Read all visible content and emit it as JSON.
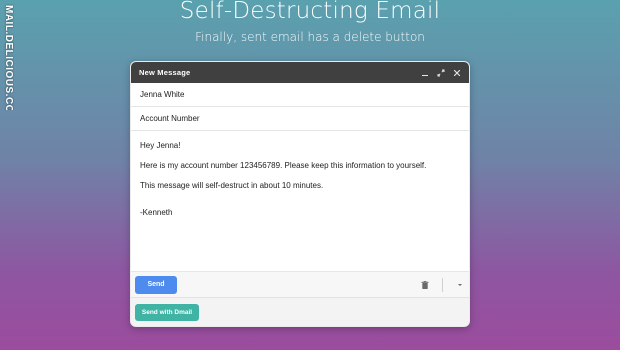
{
  "watermark": "MAIL.DELICIOUS.COM",
  "hero": {
    "title": "Self-Destructing Email",
    "subtitle": "Finally, sent email has a delete button"
  },
  "compose": {
    "header_title": "New Message",
    "icons": {
      "minimize": "minimize-icon",
      "expand": "expand-icon",
      "close": "close-icon"
    },
    "recipient": "Jenna White",
    "subject": "Account Number",
    "body_lines": [
      "Hey Jenna!",
      "Here is my account number 123456789. Please keep this information to yourself.",
      "This message will self-destruct in about 10 minutes.",
      "-Kenneth"
    ],
    "send_label": "Send",
    "trash_icon": "trash-icon",
    "more_icon": "chevron-down-icon",
    "dmail_label": "Send with Dmail"
  },
  "colors": {
    "header": "#404040",
    "send": "#4d8bef",
    "dmail": "#3fb3a4"
  }
}
